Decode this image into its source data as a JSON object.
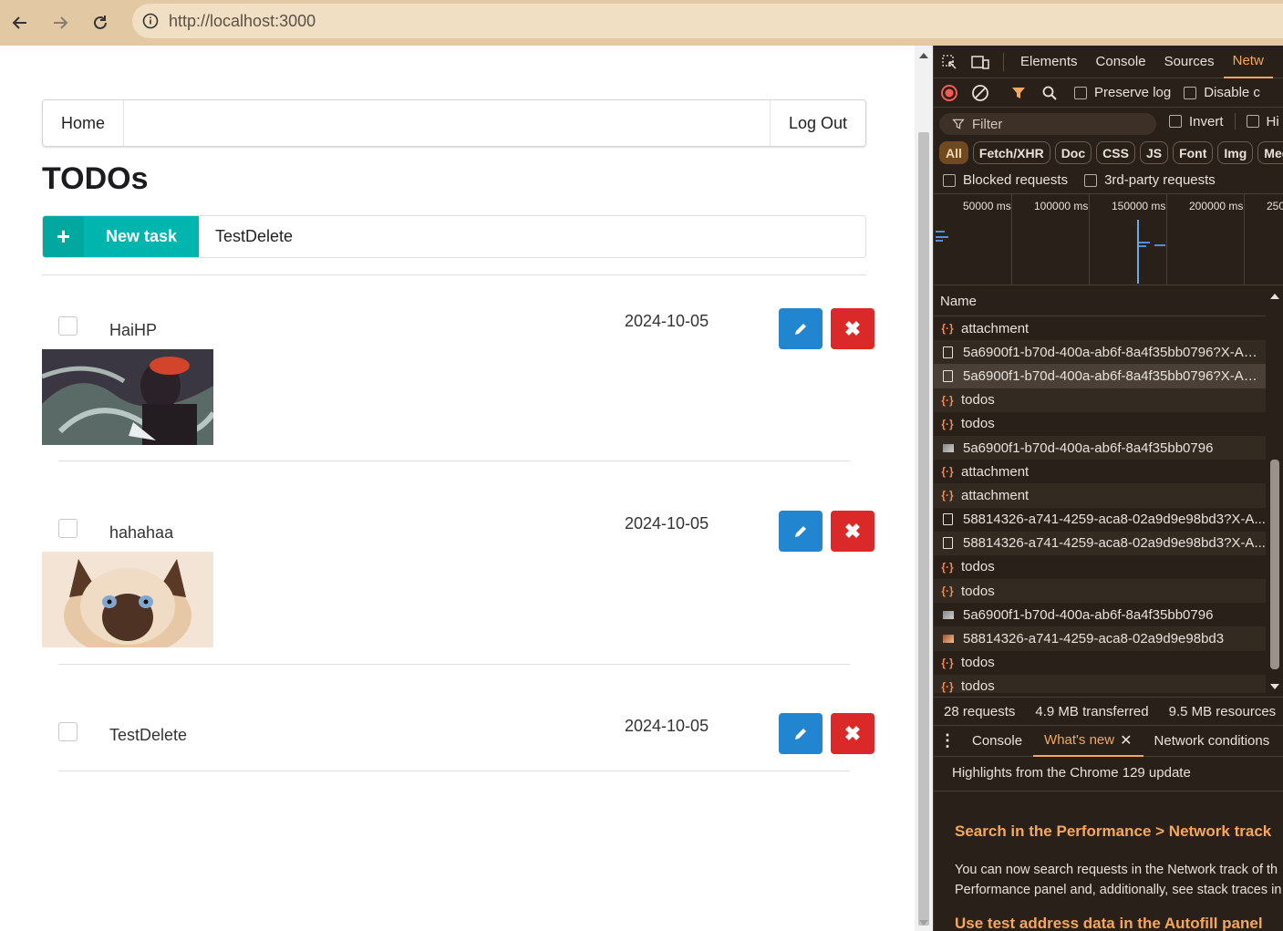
{
  "browser": {
    "url": "http://localhost:3000"
  },
  "app": {
    "menu": {
      "home": "Home",
      "logout": "Log Out"
    },
    "title": "TODOs",
    "new_task": {
      "button_label": "New task",
      "input_value": "TestDelete"
    },
    "todos": [
      {
        "name": "HaiHP",
        "date": "2024-10-05",
        "has_image": true
      },
      {
        "name": "hahahaa",
        "date": "2024-10-05",
        "has_image": true
      },
      {
        "name": "TestDelete",
        "date": "2024-10-05",
        "has_image": false
      }
    ],
    "colors": {
      "teal": "#00b5ad",
      "blue": "#2185d0",
      "red": "#db2828"
    }
  },
  "devtools": {
    "tabs": [
      "Elements",
      "Console",
      "Sources",
      "Netw"
    ],
    "active_tab": "Netw",
    "preserve_log": "Preserve log",
    "disable_cache": "Disable c",
    "filter_placeholder": "Filter",
    "invert": "Invert",
    "hide": "Hi",
    "chips": [
      "All",
      "Fetch/XHR",
      "Doc",
      "CSS",
      "JS",
      "Font",
      "Img",
      "Med"
    ],
    "blocked_requests": "Blocked requests",
    "third_party": "3rd-party requests",
    "timeline_ticks": [
      "50000 ms",
      "100000 ms",
      "150000 ms",
      "200000 ms",
      "250"
    ],
    "name_header": "Name",
    "requests": [
      {
        "type": "xhr",
        "name": "attachment"
      },
      {
        "type": "doc",
        "name": "5a6900f1-b70d-400a-ab6f-8a4f35bb0796?X-Am..."
      },
      {
        "type": "doc",
        "name": "5a6900f1-b70d-400a-ab6f-8a4f35bb0796?X-Am..."
      },
      {
        "type": "xhr",
        "name": "todos"
      },
      {
        "type": "xhr",
        "name": "todos"
      },
      {
        "type": "img",
        "name": "5a6900f1-b70d-400a-ab6f-8a4f35bb0796"
      },
      {
        "type": "xhr",
        "name": "attachment"
      },
      {
        "type": "xhr",
        "name": "attachment"
      },
      {
        "type": "doc",
        "name": "58814326-a741-4259-aca8-02a9d9e98bd3?X-A..."
      },
      {
        "type": "doc",
        "name": "58814326-a741-4259-aca8-02a9d9e98bd3?X-A..."
      },
      {
        "type": "xhr",
        "name": "todos"
      },
      {
        "type": "xhr",
        "name": "todos"
      },
      {
        "type": "img",
        "name": "5a6900f1-b70d-400a-ab6f-8a4f35bb0796"
      },
      {
        "type": "img2",
        "name": "58814326-a741-4259-aca8-02a9d9e98bd3"
      },
      {
        "type": "xhr",
        "name": "todos"
      },
      {
        "type": "xhr",
        "name": "todos"
      }
    ],
    "summary": {
      "requests": "28 requests",
      "transferred": "4.9 MB transferred",
      "resources": "9.5 MB resources"
    },
    "drawer": {
      "console": "Console",
      "whats_new": "What's new",
      "network_conditions": "Network conditions"
    },
    "whats_new": {
      "headline": "Highlights from the Chrome 129 update",
      "item1_title": "Search in the Performance > Network track",
      "item1_text_line1": "You can now search requests in the Network track of th",
      "item1_text_line2": "Performance panel and, additionally, see stack traces in",
      "item2_title": "Use test address data in the Autofill panel"
    }
  }
}
